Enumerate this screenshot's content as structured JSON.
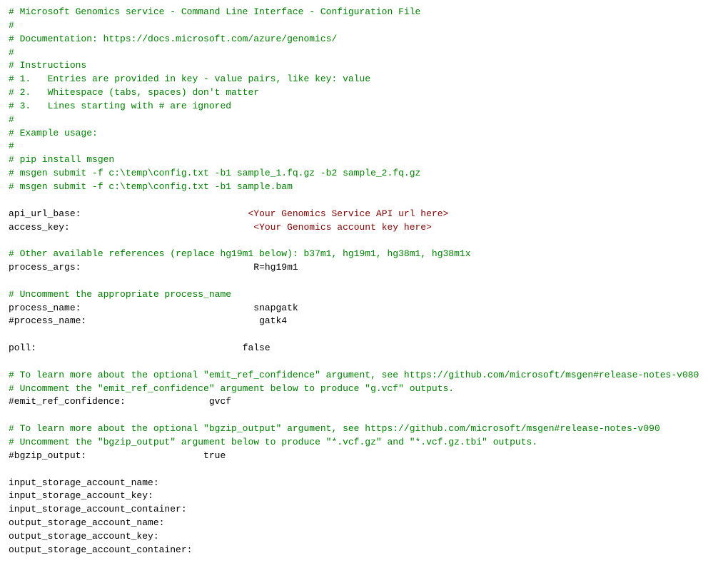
{
  "title": "Microsoft Genomics Configuration File",
  "lines": [
    {
      "type": "comment",
      "text": "# Microsoft Genomics service - Command Line Interface - Configuration File"
    },
    {
      "type": "comment",
      "text": "#"
    },
    {
      "type": "comment",
      "text": "# Documentation: https://docs.microsoft.com/azure/genomics/"
    },
    {
      "type": "comment",
      "text": "#"
    },
    {
      "type": "comment",
      "text": "# Instructions"
    },
    {
      "type": "comment",
      "text": "# 1.   Entries are provided in key - value pairs, like key: value"
    },
    {
      "type": "comment",
      "text": "# 2.   Whitespace (tabs, spaces) don't matter"
    },
    {
      "type": "comment",
      "text": "# 3.   Lines starting with # are ignored"
    },
    {
      "type": "comment",
      "text": "#"
    },
    {
      "type": "comment",
      "text": "# Example usage:"
    },
    {
      "type": "comment",
      "text": "#"
    },
    {
      "type": "comment",
      "text": "# pip install msgen"
    },
    {
      "type": "comment",
      "text": "# msgen submit -f c:\\temp\\config.txt -b1 sample_1.fq.gz -b2 sample_2.fq.gz"
    },
    {
      "type": "comment",
      "text": "# msgen submit -f c:\\temp\\config.txt -b1 sample.bam"
    },
    {
      "type": "empty",
      "text": ""
    },
    {
      "type": "keyvalue",
      "key": "api_url_base:",
      "spaces": "                              ",
      "value": "<Your Genomics Service API url here>"
    },
    {
      "type": "keyvalue",
      "key": "access_key:",
      "spaces": "                                 ",
      "value": "<Your Genomics account key here>"
    },
    {
      "type": "empty",
      "text": ""
    },
    {
      "type": "comment",
      "text": "# Other available references (replace hg19m1 below): b37m1, hg19m1, hg38m1, hg38m1x"
    },
    {
      "type": "keyvalue",
      "key": "process_args:",
      "spaces": "                               ",
      "value": "R=hg19m1"
    },
    {
      "type": "empty",
      "text": ""
    },
    {
      "type": "comment",
      "text": "# Uncomment the appropriate process_name"
    },
    {
      "type": "keyvalue",
      "key": "process_name:",
      "spaces": "                               ",
      "value": "snapgatk"
    },
    {
      "type": "keyvalue",
      "key": "#process_name:",
      "spaces": "                              ",
      "value": " gatk4"
    },
    {
      "type": "empty",
      "text": ""
    },
    {
      "type": "keyvalue",
      "key": "poll:",
      "spaces": "                                     ",
      "value": "false"
    },
    {
      "type": "empty",
      "text": ""
    },
    {
      "type": "comment",
      "text": "# To learn more about the optional \"emit_ref_confidence\" argument, see https://github.com/microsoft/msgen#release-notes-v080"
    },
    {
      "type": "comment",
      "text": "# Uncomment the \"emit_ref_confidence\" argument below to produce \"g.vcf\" outputs."
    },
    {
      "type": "keyvalue",
      "key": "#emit_ref_confidence:",
      "spaces": "               ",
      "value": "gvcf"
    },
    {
      "type": "empty",
      "text": ""
    },
    {
      "type": "comment",
      "text": "# To learn more about the optional \"bgzip_output\" argument, see https://github.com/microsoft/msgen#release-notes-v090"
    },
    {
      "type": "comment",
      "text": "# Uncomment the \"bgzip_output\" argument below to produce \"*.vcf.gz\" and \"*.vcf.gz.tbi\" outputs."
    },
    {
      "type": "keyvalue",
      "key": "#bgzip_output:",
      "spaces": "                     ",
      "value": "true"
    },
    {
      "type": "empty",
      "text": ""
    },
    {
      "type": "keyonly",
      "text": "input_storage_account_name:"
    },
    {
      "type": "keyonly",
      "text": "input_storage_account_key:"
    },
    {
      "type": "keyonly",
      "text": "input_storage_account_container:"
    },
    {
      "type": "keyonly",
      "text": "output_storage_account_name:"
    },
    {
      "type": "keyonly",
      "text": "output_storage_account_key:"
    },
    {
      "type": "keyonly",
      "text": "output_storage_account_container:"
    }
  ]
}
